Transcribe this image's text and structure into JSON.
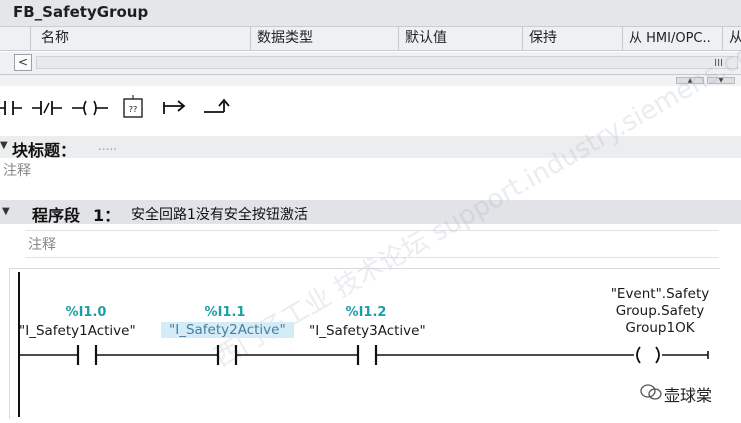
{
  "block": {
    "name": "FB_SafetyGroup"
  },
  "interface_table": {
    "columns": [
      "名称",
      "数据类型",
      "默认值",
      "保持",
      "从 HMI/OPC..",
      "从"
    ]
  },
  "scrollbar": {
    "left_arrow": "<",
    "grip": "III"
  },
  "toolbar": {
    "items": [
      {
        "name": "contact-no-icon",
        "tip": "Normally open contact"
      },
      {
        "name": "contact-nc-icon",
        "tip": "Normally closed contact"
      },
      {
        "name": "coil-icon",
        "tip": "Coil"
      },
      {
        "name": "empty-box-icon",
        "tip": "Empty box",
        "glyph": "??"
      },
      {
        "name": "branch-open-icon",
        "tip": "Open branch"
      },
      {
        "name": "branch-close-icon",
        "tip": "Close branch"
      }
    ]
  },
  "block_title": {
    "label": "块标题：",
    "placeholder": ".....",
    "comment": "注释"
  },
  "network": {
    "label": "程序段",
    "number": "1：",
    "title": "安全回路1没有安全按钮激活",
    "comment": "注释",
    "contacts": [
      {
        "address": "%I1.0",
        "tag": "\"I_Safety1Active\"",
        "selected": false
      },
      {
        "address": "%I1.1",
        "tag": "\"I_Safety2Active\"",
        "selected": true
      },
      {
        "address": "%I1.2",
        "tag": "\"I_Safety3Active\"",
        "selected": false
      }
    ],
    "coil": {
      "tag_lines": [
        "\"Event\".Safety",
        "Group.Safety",
        "Group1OK"
      ]
    }
  },
  "watermark": "西门子工业  技术论坛  support.industry.siemens.com/cs",
  "brand": "壶球棠",
  "colors": {
    "address": "#1d9fa8",
    "selection": "#d4ecf7",
    "header_bg": "#e1e3e6"
  }
}
